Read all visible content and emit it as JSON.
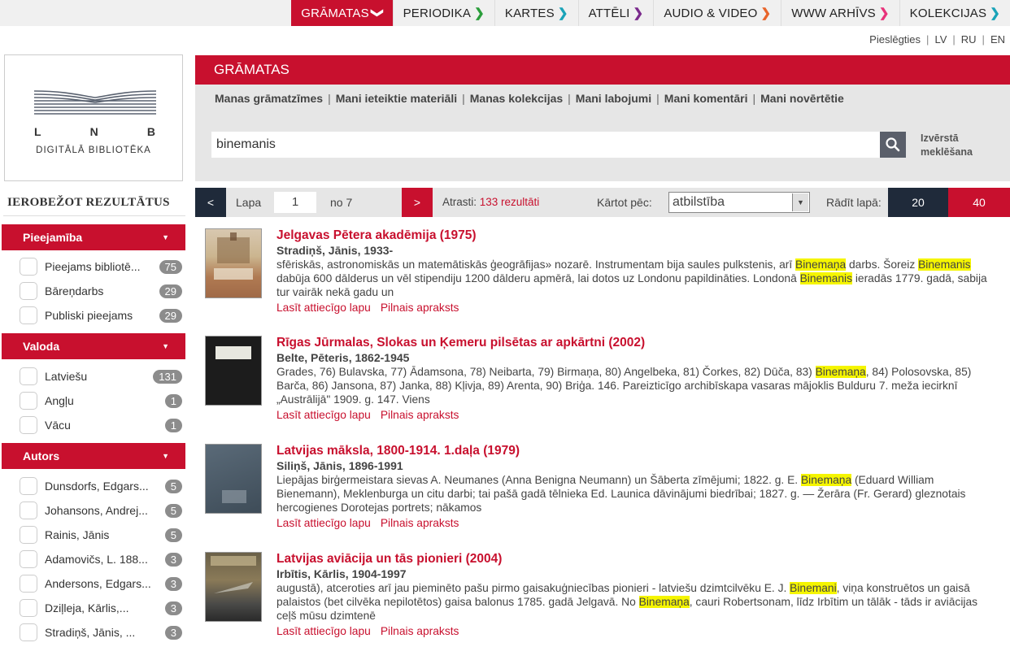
{
  "nav": {
    "items": [
      {
        "label": "GRĀMATAS",
        "arrow": "❯",
        "color": "#ffffff"
      },
      {
        "label": "PERIODIKA",
        "arrow": "❯",
        "color": "#2a9d3a"
      },
      {
        "label": "KARTES",
        "arrow": "❯",
        "color": "#1aa3b8"
      },
      {
        "label": "ATTĒLI",
        "arrow": "❯",
        "color": "#7a2a8c"
      },
      {
        "label": "AUDIO & VIDEO",
        "arrow": "❯",
        "color": "#e8642a"
      },
      {
        "label": "WWW ARHĪVS",
        "arrow": "❯",
        "color": "#e8327a"
      },
      {
        "label": "KOLEKCIJAS",
        "arrow": "❯",
        "color": "#1aa3b8"
      }
    ]
  },
  "lang": {
    "login": "Pieslēgties",
    "lv": "LV",
    "ru": "RU",
    "en": "EN"
  },
  "logo": {
    "l": "L",
    "n": "N",
    "b": "B",
    "subtitle": "DIGITĀLĀ BIBLIOTĒKA"
  },
  "sidebar": {
    "title": "IEROBEŽOT REZULTĀTUS",
    "facets": {
      "access": {
        "title": "Pieejamība",
        "items": [
          {
            "label": "Pieejams bibliotē...",
            "count": "75"
          },
          {
            "label": "Bāreņdarbs",
            "count": "29"
          },
          {
            "label": "Publiski pieejams",
            "count": "29"
          }
        ]
      },
      "language": {
        "title": "Valoda",
        "items": [
          {
            "label": "Latviešu",
            "count": "131"
          },
          {
            "label": "Angļu",
            "count": "1"
          },
          {
            "label": "Vācu",
            "count": "1"
          }
        ]
      },
      "author": {
        "title": "Autors",
        "items": [
          {
            "label": "Dunsdorfs, Edgars...",
            "count": "5"
          },
          {
            "label": "Johansons, Andrej...",
            "count": "5"
          },
          {
            "label": "Rainis, Jānis",
            "count": "5"
          },
          {
            "label": "Adamovičs, L. 188...",
            "count": "3"
          },
          {
            "label": "Andersons, Edgars...",
            "count": "3"
          },
          {
            "label": "Dziļleja, Kārlis,...",
            "count": "3"
          },
          {
            "label": "Stradiņš, Jānis, ...",
            "count": "3"
          }
        ]
      }
    }
  },
  "main": {
    "title": "GRĀMATAS",
    "subnav": [
      "Manas grāmatzīmes",
      "Mani ieteiktie materiāli",
      "Manas kolekcijas",
      "Mani labojumi",
      "Mani komentāri",
      "Mani novērtētie"
    ],
    "search": {
      "value": "binemanis",
      "advanced": "Izvērstā meklēšana"
    },
    "pager": {
      "prev": "<",
      "next": ">",
      "page_label": "Lapa",
      "page": "1",
      "of": "no 7",
      "found_label": "Atrasti: ",
      "found_value": "133 rezultāti",
      "sort_label": "Kārtot pēc:",
      "sort_value": "atbilstība",
      "show_label": "Rādīt lapā:",
      "pp1": "20",
      "pp2": "40"
    },
    "links": {
      "read": "Lasīt attiecīgo lapu",
      "full": "Pilnais apraksts"
    },
    "results": [
      {
        "title": "Jelgavas Pētera akadēmija (1975)",
        "author": "Stradiņš, Jānis, 1933-",
        "s1": "sfēriskās, astronomiskās un matemātiskās ģeogrāfijas» nozarē. Instrumentam bija saules pulkstenis, arī ",
        "h1": "Binemaņa",
        "s2": " darbs. Šoreiz ",
        "h2": "Binemanis",
        "s3": " dabūja 600 dālderus un vēl stipendiju 1200 dālderu apmērā, lai dotos uz Londonu papildināties. Londonā ",
        "h3": "Binemanis",
        "s4": " ieradās 1779. gadā, sabija tur vairāk nekā gadu un"
      },
      {
        "title": "Rīgas Jūrmalas, Slokas un Ķemeru pilsētas ar apkārtni (2002)",
        "author": "Belte, Pēteris, 1862-1945",
        "s1": "Grades, 76) Bulavska, 77) Ādamsona, 78) Neibarta, 79) Birmaņa, 80) Angelbeka, 81) Čorkes, 82) Dūča, 83) ",
        "h1": "Binemaņa",
        "s2": ", 84) Polosovska, 85) Barča, 86) Jansona, 87) Janka, 88) Kļivja, 89) Arenta, 90) Briģa. 146. Pareizticīgo archibīskapa vasaras mājoklis Bulduru 7. meža iecirknī „Austrālijā\" 1909. g. 147. Viens"
      },
      {
        "title": "Latvijas māksla, 1800-1914. 1.daļa (1979)",
        "author": "Siliņš, Jānis, 1896-1991",
        "s1": "Liepājas birģermeistara sievas A. Neumanes (Anna Benigna Neumann) un Šāberta zīmējumi; 1822. g. E. ",
        "h1": "Binemaņa",
        "s2": " (Eduard William Bienemann), Meklenburga un citu darbi; tai pašā gadā tēlnieka Ed. Launica dāvinājumi biedrībai; 1827. g. — Žerāra (Fr. Gerard) gleznotais hercogienes Dorotejas portrets; nākamos"
      },
      {
        "title": "Latvijas aviācija un tās pionieri (2004)",
        "author": "Irbītis, Kārlis, 1904-1997",
        "s1": "augustā), atceroties arī jau pieminēto pašu pirmo gaisakuģniecības pionieri - latviešu dzimtcilvēku E. J. ",
        "h1": "Binemani",
        "s2": ", viņa konstruētos un gaisā palaistos (bet cilvēka nepilotētos) gaisa balonus 1785. gadā Jelgavā. No ",
        "h2": "Binemaņa",
        "s3": ", cauri Robertsonam, līdz Irbītim un tālāk - tāds ir aviācijas ceļš mūsu dzimtenē"
      }
    ]
  },
  "colors": {
    "brand_red": "#c8102e",
    "dark_navy": "#1f2a3a",
    "highlight": "#f5f500"
  }
}
